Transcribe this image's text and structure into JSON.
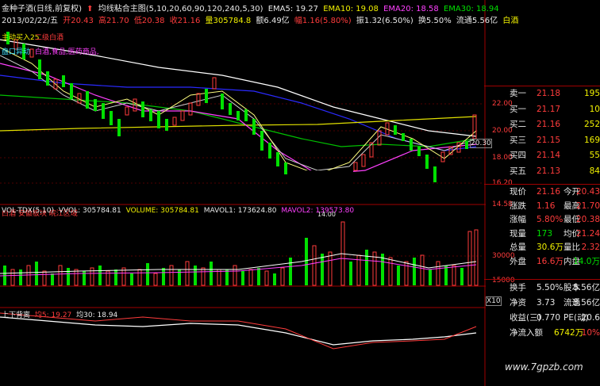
{
  "header": {
    "stock_name": "金种子酒(日线,前复权)",
    "indicator_name": "均线粘合主图(5,10,20,60,90,120,240,5,30)",
    "ema5": "EMA5: 19.27",
    "ema10": "EMA10: 19.08",
    "ema20": "EMA20: 18.58",
    "ema30": "EMA30: 18.94",
    "date": "2013/02/22/五",
    "open": "开20.43",
    "high": "高21.70",
    "low": "低20.38",
    "close": "收21.16",
    "volume": "量305784.8",
    "amount": "额6.49亿",
    "range": "幅1.16(5.80%)",
    "amplitude": "振1.32(6.50%)",
    "turnover": "换5.50%",
    "float": "流通5.56亿",
    "sector": "白酒"
  },
  "main_chart": {
    "annotation1": "主动买入25",
    "annotation2": "二级白酒",
    "annotation3": "盘口异动",
    "annotation4": "白酒,食品,医药商品,",
    "bottom_note": "白酒 安徽板块 皖江区域",
    "mark_price": "20.30",
    "low_mark": "14.00",
    "y_labels": [
      "22.00",
      "20.00",
      "18.00",
      "16.20",
      "14.58"
    ]
  },
  "volume_chart": {
    "indicator": "VOL-TDX(5,10)",
    "vvol": "VVOL: 305784.81",
    "volume": "VOLUME: 305784.81",
    "mavol1": "MAVOL1: 173624.80",
    "mavol2": "MAVOL2: 139573.80",
    "y_labels": [
      "30000",
      "15000",
      "X10"
    ]
  },
  "bottom_chart": {
    "indicator": "上下背离",
    "ma5": "均5: 19.27",
    "ma30": "均30: 18.94"
  },
  "quote": {
    "asks": [
      {
        "label": "卖一",
        "price": "21.18",
        "vol": "195"
      }
    ],
    "bids": [
      {
        "label": "买一",
        "price": "21.17",
        "vol": "10"
      },
      {
        "label": "买二",
        "price": "21.16",
        "vol": "252"
      },
      {
        "label": "买三",
        "price": "21.15",
        "vol": "169"
      },
      {
        "label": "买四",
        "price": "21.14",
        "vol": "55"
      },
      {
        "label": "买五",
        "price": "21.13",
        "vol": "84"
      }
    ],
    "stats": [
      {
        "l1": "现价",
        "v1": "21.16",
        "l2": "今开",
        "v2": "20.43"
      },
      {
        "l1": "涨跌",
        "v1": "1.16",
        "l2": "最高",
        "v2": "21.70"
      },
      {
        "l1": "涨幅",
        "v1": "5.80%",
        "l2": "最低",
        "v2": "20.38"
      },
      {
        "l1": "现量",
        "v1": "173",
        "l2": "均价",
        "v2": "21.24"
      },
      {
        "l1": "总量",
        "v1": "30.6万",
        "l2": "量比",
        "v2": "2.32"
      },
      {
        "l1": "外盘",
        "v1": "16.6万",
        "l2": "内盘",
        "v2": "14.0万"
      }
    ],
    "stats2": [
      {
        "l1": "换手",
        "v1": "5.50%",
        "l2": "股本",
        "v2": "5.56亿"
      },
      {
        "l1": "净资",
        "v1": "3.73",
        "l2": "流通",
        "v2": "5.56亿"
      },
      {
        "l1": "收益(三)",
        "v1": "0.770",
        "l2": "PE(动)",
        "v2": "20.6"
      },
      {
        "l1": "净流入额",
        "v1": "6742万",
        "l2": "",
        "v2": "10%"
      }
    ]
  },
  "watermark": "www.7gpzb.com",
  "colors": {
    "up": "#ff3c3c",
    "down": "#00e000",
    "bg": "#000000",
    "grid": "#a00000"
  }
}
